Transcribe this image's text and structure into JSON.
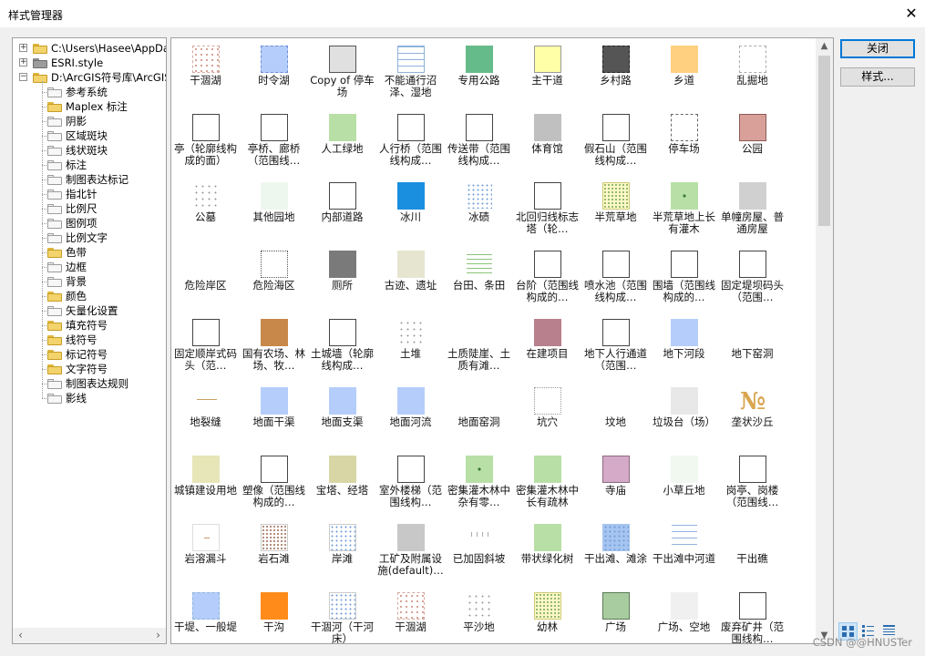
{
  "window": {
    "title": "样式管理器"
  },
  "tree": [
    {
      "label": "C:\\Users\\Hasee\\AppData",
      "icon": "folder-filled",
      "level": 0,
      "expander": "+"
    },
    {
      "label": "ESRI.style",
      "icon": "folder-gray",
      "level": 0,
      "expander": "+"
    },
    {
      "label": "D:\\ArcGIS符号库\\ArcGIS",
      "icon": "folder-filled",
      "level": 0,
      "expander": "-"
    },
    {
      "label": "参考系统",
      "icon": "folder-empty",
      "level": 1
    },
    {
      "label": "Maplex 标注",
      "icon": "folder-filled",
      "level": 1
    },
    {
      "label": "阴影",
      "icon": "folder-empty",
      "level": 1
    },
    {
      "label": "区域斑块",
      "icon": "folder-empty",
      "level": 1
    },
    {
      "label": "线状斑块",
      "icon": "folder-empty",
      "level": 1
    },
    {
      "label": "标注",
      "icon": "folder-empty",
      "level": 1
    },
    {
      "label": "制图表达标记",
      "icon": "folder-empty",
      "level": 1
    },
    {
      "label": "指北针",
      "icon": "folder-empty",
      "level": 1
    },
    {
      "label": "比例尺",
      "icon": "folder-empty",
      "level": 1
    },
    {
      "label": "图例项",
      "icon": "folder-empty",
      "level": 1
    },
    {
      "label": "比例文字",
      "icon": "folder-empty",
      "level": 1
    },
    {
      "label": "色带",
      "icon": "folder-filled",
      "level": 1
    },
    {
      "label": "边框",
      "icon": "folder-empty",
      "level": 1
    },
    {
      "label": "背景",
      "icon": "folder-empty",
      "level": 1
    },
    {
      "label": "颜色",
      "icon": "folder-filled",
      "level": 1
    },
    {
      "label": "矢量化设置",
      "icon": "folder-empty",
      "level": 1
    },
    {
      "label": "填充符号",
      "icon": "folder-filled",
      "level": 1
    },
    {
      "label": "线符号",
      "icon": "folder-filled",
      "level": 1
    },
    {
      "label": "标记符号",
      "icon": "folder-filled",
      "level": 1
    },
    {
      "label": "文字符号",
      "icon": "folder-filled",
      "level": 1
    },
    {
      "label": "制图表达规则",
      "icon": "folder-empty",
      "level": 1
    },
    {
      "label": "影线",
      "icon": "folder-empty",
      "level": 1
    }
  ],
  "symbols": [
    {
      "label": "干涸湖",
      "fill": "#ffffff",
      "border": "#d4a9a0",
      "style": "dashed-dots"
    },
    {
      "label": "时令湖",
      "fill": "#b5cdfa",
      "border": "#6b8fd6",
      "style": "dashed"
    },
    {
      "label": "Copy of 停车场",
      "fill": "#e0e0e0",
      "border": "#555555",
      "style": "solid"
    },
    {
      "label": "不能通行沼泽、湿地",
      "fill": "#ffffff",
      "border": "#8fb3d9",
      "style": "lines"
    },
    {
      "label": "专用公路",
      "fill": "#66bb8a",
      "border": "#66bb8a",
      "style": "solid"
    },
    {
      "label": "主干道",
      "fill": "#ffffa8",
      "border": "#999999",
      "style": "solid"
    },
    {
      "label": "乡村路",
      "fill": "#555555",
      "border": "#222222",
      "style": "dashed"
    },
    {
      "label": "乡道",
      "fill": "#ffd080",
      "border": "#ffd080",
      "style": "solid"
    },
    {
      "label": "乱掘地",
      "fill": "#ffffff",
      "border": "#aaaaaa",
      "style": "dashed"
    },
    {
      "label": "亭（轮廓线构成的面）",
      "fill": "#ffffff",
      "border": "#444444",
      "style": "solid"
    },
    {
      "label": "亭桥、廊桥（范围线…",
      "fill": "#ffffff",
      "border": "#444444",
      "style": "solid"
    },
    {
      "label": "人工绿地",
      "fill": "#b8e0a6",
      "border": "#b8e0a6",
      "style": "solid"
    },
    {
      "label": "人行桥（范围线构成…",
      "fill": "#ffffff",
      "border": "#444444",
      "style": "solid"
    },
    {
      "label": "传送带（范围线构成…",
      "fill": "#ffffff",
      "border": "#444444",
      "style": "solid"
    },
    {
      "label": "体育馆",
      "fill": "#c0c0c0",
      "border": "#c0c0c0",
      "style": "solid"
    },
    {
      "label": "假石山（范围线构成…",
      "fill": "#ffffff",
      "border": "#444444",
      "style": "solid"
    },
    {
      "label": "停车场",
      "fill": "#ffffff",
      "border": "#666666",
      "style": "dashed"
    },
    {
      "label": "公园",
      "fill": "#d9a09a",
      "border": "#8a5a55",
      "style": "solid"
    },
    {
      "label": "公墓",
      "fill": "#ffffff",
      "border": "#ffffff",
      "style": "dots"
    },
    {
      "label": "其他园地",
      "fill": "#eef7ee",
      "border": "#eef7ee",
      "style": "solid"
    },
    {
      "label": "内部道路",
      "fill": "#ffffff",
      "border": "#444444",
      "style": "solid"
    },
    {
      "label": "冰川",
      "fill": "#1a8fe0",
      "border": "#1a8fe0",
      "style": "solid"
    },
    {
      "label": "冰碛",
      "fill": "#ffffff",
      "border": "#ffffff",
      "style": "dots-blue"
    },
    {
      "label": "北回归线标志塔（轮…",
      "fill": "#ffffff",
      "border": "#444444",
      "style": "solid"
    },
    {
      "label": "半荒草地",
      "fill": "#fff8c8",
      "border": "#cccc77",
      "style": "dots-green"
    },
    {
      "label": "半荒草地上长有灌木",
      "fill": "#b8e0a6",
      "border": "#b8e0a6",
      "style": "tree"
    },
    {
      "label": "单幢房屋、普通房屋",
      "fill": "#d0d0d0",
      "border": "#d0d0d0",
      "style": "solid"
    },
    {
      "label": "危险岸区",
      "fill": "#ffffff",
      "border": "#ffffff",
      "style": "solid"
    },
    {
      "label": "危险海区",
      "fill": "#ffffff",
      "border": "#555555",
      "style": "dotted"
    },
    {
      "label": "厕所",
      "fill": "#7a7a7a",
      "border": "#7a7a7a",
      "style": "solid"
    },
    {
      "label": "古迹、遗址",
      "fill": "#e6e6d0",
      "border": "#e6e6d0",
      "style": "solid"
    },
    {
      "label": "台田、条田",
      "fill": "#ffffff",
      "border": "#ffffff",
      "style": "green-lines"
    },
    {
      "label": "台阶（范围线构成的…",
      "fill": "#ffffff",
      "border": "#444444",
      "style": "solid"
    },
    {
      "label": "喷水池（范围线构成…",
      "fill": "#ffffff",
      "border": "#444444",
      "style": "solid"
    },
    {
      "label": "围墙（范围线构成的…",
      "fill": "#ffffff",
      "border": "#444444",
      "style": "solid"
    },
    {
      "label": "固定堤坝码头（范围…",
      "fill": "#ffffff",
      "border": "#444444",
      "style": "solid"
    },
    {
      "label": "固定顺岸式码头（范…",
      "fill": "#ffffff",
      "border": "#444444",
      "style": "solid"
    },
    {
      "label": "国有农场、林场、牧…",
      "fill": "#c8884a",
      "border": "#c8884a",
      "style": "solid"
    },
    {
      "label": "土城墙（轮廓线构成…",
      "fill": "#ffffff",
      "border": "#444444",
      "style": "solid"
    },
    {
      "label": "土堆",
      "fill": "#ffffff",
      "border": "#ffffff",
      "style": "dots"
    },
    {
      "label": "土质陡崖、土质有滩…",
      "fill": "#ffffff",
      "border": "#ffffff",
      "style": "grid-tan"
    },
    {
      "label": "在建项目",
      "fill": "#b8808c",
      "border": "#b8808c",
      "style": "solid"
    },
    {
      "label": "地下人行通道（范围…",
      "fill": "#ffffff",
      "border": "#444444",
      "style": "solid"
    },
    {
      "label": "地下河段",
      "fill": "#b5cdfa",
      "border": "#b5cdfa",
      "style": "dotted"
    },
    {
      "label": "地下窑洞",
      "fill": "#ffffff",
      "border": "#ffffff",
      "style": "solid"
    },
    {
      "label": "地裂缝",
      "fill": "#ffffff",
      "border": "#ffffff",
      "style": "crack"
    },
    {
      "label": "地面干渠",
      "fill": "#b5cdfa",
      "border": "#b5cdfa",
      "style": "solid"
    },
    {
      "label": "地面支渠",
      "fill": "#b5cdfa",
      "border": "#b5cdfa",
      "style": "solid"
    },
    {
      "label": "地面河流",
      "fill": "#b5cdfa",
      "border": "#b5cdfa",
      "style": "solid"
    },
    {
      "label": "地面窑洞",
      "fill": "#ffffff",
      "border": "#ffffff",
      "style": "solid"
    },
    {
      "label": "坑穴",
      "fill": "#ffffff",
      "border": "#999999",
      "style": "dotted"
    },
    {
      "label": "坟地",
      "fill": "#ffffff",
      "border": "#ffffff",
      "style": "solid"
    },
    {
      "label": "垃圾台（场）",
      "fill": "#e8e8e8",
      "border": "#e8e8e8",
      "style": "solid"
    },
    {
      "label": "垄状沙丘",
      "fill": "#ffffff",
      "border": "#ffffff",
      "style": "sand"
    },
    {
      "label": "城镇建设用地",
      "fill": "#e6e6b8",
      "border": "#e6e6b8",
      "style": "solid"
    },
    {
      "label": "塑像（范围线构成的…",
      "fill": "#ffffff",
      "border": "#444444",
      "style": "solid"
    },
    {
      "label": "宝塔、经塔",
      "fill": "#d8d6a4",
      "border": "#d8d6a4",
      "style": "solid"
    },
    {
      "label": "室外楼梯（范围线构…",
      "fill": "#ffffff",
      "border": "#444444",
      "style": "solid"
    },
    {
      "label": "密集灌木林中杂有零…",
      "fill": "#b8e0a6",
      "border": "#b8e0a6",
      "style": "tree"
    },
    {
      "label": "密集灌木林中长有疏林",
      "fill": "#b8e0a6",
      "border": "#b8e0a6",
      "style": "solid"
    },
    {
      "label": "寺庙",
      "fill": "#d4aac8",
      "border": "#8a6a80",
      "style": "solid"
    },
    {
      "label": "小草丘地",
      "fill": "#f0f8f0",
      "border": "#f0f8f0",
      "style": "solid"
    },
    {
      "label": "岗亭、岗楼（范围线…",
      "fill": "#ffffff",
      "border": "#444444",
      "style": "solid"
    },
    {
      "label": "岩溶漏斗",
      "fill": "#ffffff",
      "border": "#dddddd",
      "style": "karst"
    },
    {
      "label": "岩石滩",
      "fill": "#ffffff",
      "border": "#cccccc",
      "style": "dots-brown"
    },
    {
      "label": "岸滩",
      "fill": "#ffffff",
      "border": "#cccccc",
      "style": "dots-blue"
    },
    {
      "label": "工矿及附属设施(default)…",
      "fill": "#c8c8c8",
      "border": "#c8c8c8",
      "style": "solid"
    },
    {
      "label": "已加固斜坡",
      "fill": "#ffffff",
      "border": "#ffffff",
      "style": "slope"
    },
    {
      "label": "带状绿化树",
      "fill": "#b8e0a6",
      "border": "#b8e0a6",
      "style": "solid"
    },
    {
      "label": "干出滩、滩涂",
      "fill": "#a6c4f0",
      "border": "#a6c4f0",
      "style": "dots-blue"
    },
    {
      "label": "干出滩中河道",
      "fill": "#ffffff",
      "border": "#ffffff",
      "style": "lines"
    },
    {
      "label": "干出礁",
      "fill": "#ffffff",
      "border": "#ffffff",
      "style": "solid"
    },
    {
      "label": "干堤、一般堤",
      "fill": "#b5cdfa",
      "border": "#8fb3d9",
      "style": "dashed"
    },
    {
      "label": "干沟",
      "fill": "#ff8c1a",
      "border": "#ff8c1a",
      "style": "solid"
    },
    {
      "label": "干涸河（干河床）",
      "fill": "#ffffff",
      "border": "#cccccc",
      "style": "dots-blue"
    },
    {
      "label": "干涸湖",
      "fill": "#ffffff",
      "border": "#d4a9a0",
      "style": "dashed-dots"
    },
    {
      "label": "平沙地",
      "fill": "#ffffff",
      "border": "#ffffff",
      "style": "dots"
    },
    {
      "label": "幼林",
      "fill": "#fff8c8",
      "border": "#cccc77",
      "style": "dots-green"
    },
    {
      "label": "广场",
      "fill": "#a8cca0",
      "border": "#5a7a55",
      "style": "solid"
    },
    {
      "label": "广场、空地",
      "fill": "#f0f0f0",
      "border": "#f0f0f0",
      "style": "solid"
    },
    {
      "label": "废弃矿井（范围线构…",
      "fill": "#ffffff",
      "border": "#444444",
      "style": "solid"
    }
  ],
  "buttons": {
    "close": "关闭",
    "styles": "样式..."
  },
  "icons": {
    "close": "close-icon",
    "expand": "plus-icon",
    "collapse": "minus-icon",
    "scroll_left": "chevron-left-icon",
    "scroll_right": "chevron-right-icon",
    "scroll_up": "chevron-up-icon",
    "scroll_down": "chevron-down-icon"
  },
  "watermark": "CSDN @@HNUSTer"
}
